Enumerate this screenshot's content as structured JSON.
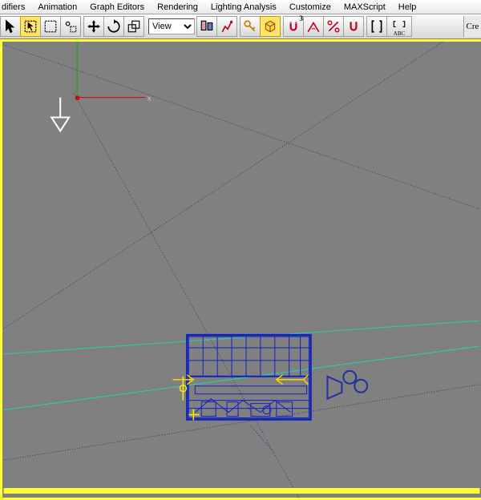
{
  "menu": {
    "items": [
      {
        "label": "difiers"
      },
      {
        "label": "Animation"
      },
      {
        "label": "Graph Editors"
      },
      {
        "label": "Rendering"
      },
      {
        "label": "Lighting Analysis"
      },
      {
        "label": "Customize"
      },
      {
        "label": "MAXScript"
      },
      {
        "label": "Help"
      }
    ]
  },
  "toolbar": {
    "select_label": "View",
    "abc_label": "ABC",
    "create_tab": "Cre",
    "snap_angle": "3"
  },
  "axes": {
    "x": "x"
  }
}
